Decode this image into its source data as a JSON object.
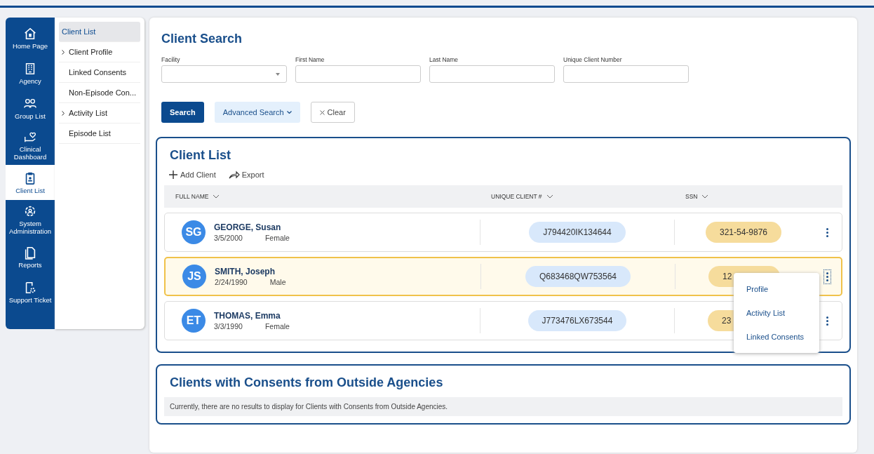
{
  "nav": {
    "items": [
      {
        "label": "Home Page",
        "selected": false
      },
      {
        "label": "Agency",
        "selected": false
      },
      {
        "label": "Group List",
        "selected": false
      },
      {
        "label": "Clinical Dashboard",
        "selected": false
      },
      {
        "label": "Client List",
        "selected": true
      },
      {
        "label": "System Administration",
        "selected": false
      },
      {
        "label": "Reports",
        "selected": false
      },
      {
        "label": "Support Ticket",
        "selected": false
      }
    ]
  },
  "submenu": {
    "items": [
      {
        "label": "Client List",
        "expandable": false,
        "selected": true
      },
      {
        "label": "Client Profile",
        "expandable": true,
        "selected": false
      },
      {
        "label": "Linked Consents",
        "expandable": false,
        "selected": false
      },
      {
        "label": "Non-Episode Con...",
        "expandable": false,
        "selected": false
      },
      {
        "label": "Activity List",
        "expandable": true,
        "selected": false
      },
      {
        "label": "Episode List",
        "expandable": false,
        "selected": false
      }
    ]
  },
  "client_search": {
    "title": "Client Search",
    "fields": [
      {
        "label": "Facility",
        "kind": "select"
      },
      {
        "label": "First Name",
        "kind": "text"
      },
      {
        "label": "Last Name",
        "kind": "text"
      },
      {
        "label": "Unique Client Number",
        "kind": "text"
      }
    ],
    "buttons": [
      {
        "label": "Search",
        "kind": "primary"
      },
      {
        "label": "Advanced Search",
        "kind": "dropdown"
      },
      {
        "label": "Clear",
        "kind": "clear"
      }
    ]
  },
  "client_list": {
    "title": "Client List",
    "actions": [
      {
        "label": "Add Client"
      },
      {
        "label": "Export"
      }
    ],
    "columns": [
      "FULL NAME",
      "UNIQUE CLIENT #",
      "SSN"
    ],
    "rows": [
      {
        "initials": "SG",
        "name": "GEORGE, Susan",
        "dob": "3/5/2000",
        "gender": "Female",
        "unique_client": "J794420IK134644",
        "ssn": "321-54-9876",
        "selected": false,
        "menu_open": false
      },
      {
        "initials": "JS",
        "name": "SMITH, Joseph",
        "dob": "2/24/1990",
        "gender": "Male",
        "unique_client": "Q683468QW753564",
        "ssn": "12",
        "selected": true,
        "menu_open": true
      },
      {
        "initials": "ET",
        "name": "THOMAS, Emma",
        "dob": "3/3/1990",
        "gender": "Female",
        "unique_client": "J773476LX673544",
        "ssn": "23",
        "selected": false,
        "menu_open": false
      }
    ],
    "row_menu": [
      "Profile",
      "Activity List",
      "Linked Consents"
    ]
  },
  "outside_consents": {
    "title": "Clients with Consents from Outside Agencies",
    "message": "Currently, there are no results to display for Clients with Consents from Outside Agencies."
  }
}
